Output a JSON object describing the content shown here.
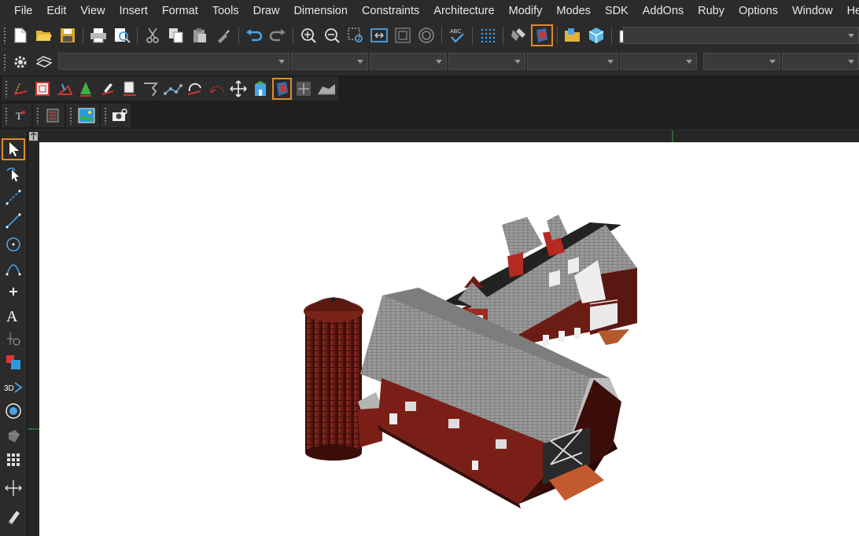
{
  "menubar": {
    "items": [
      "File",
      "Edit",
      "View",
      "Insert",
      "Format",
      "Tools",
      "Draw",
      "Dimension",
      "Constraints",
      "Architecture",
      "Modify",
      "Modes",
      "SDK",
      "AddOns",
      "Ruby",
      "Options",
      "Window",
      "Help"
    ]
  },
  "toolbars": {
    "standard": [
      "new-icon",
      "open-icon",
      "save-icon",
      "print-icon",
      "print-preview-icon",
      "cut-icon",
      "copy-icon",
      "paste-icon",
      "match-properties-icon",
      "undo-icon",
      "redo-icon",
      "zoom-in-icon",
      "zoom-out-icon",
      "zoom-window-icon",
      "zoom-extents-icon",
      "zoom-all-icon",
      "zoom-realtime-icon",
      "spell-check-icon",
      "snap-grid-icon",
      "render-icon",
      "render-shaded-icon",
      "explorer-icon",
      "3d-view-icon",
      "properties-icon"
    ],
    "render_toolbar": [
      "render-setup-icon",
      "render-material-icon",
      "render-light-icon",
      "render-spotlight-icon",
      "render-background-icon",
      "render-fog-icon",
      "render-distant-light-icon",
      "render-path-icon",
      "render-rotate-icon",
      "render-arc-icon",
      "render-move-icon",
      "render-scene-icon",
      "render-shaded-icon",
      "render-fit-icon",
      "render-land-icon"
    ],
    "small_toolbar": [
      "text-style-icon",
      "layer-list-icon",
      "image-icon",
      "camera-icon"
    ]
  },
  "left_toolbar": [
    "select-icon",
    "select-vertex-icon",
    "polyline-icon",
    "line-icon",
    "circle-icon",
    "arc-icon",
    "point-icon",
    "text-icon",
    "dimension-icon",
    "properties-icon",
    "3d-icon",
    "3d-orbit-icon",
    "solid-icon",
    "grid-icon",
    "stretch-icon",
    "eraser-icon"
  ],
  "colors": {
    "accent": "#e08a2a",
    "background": "#2b2b2b",
    "canvas": "#ffffff"
  }
}
